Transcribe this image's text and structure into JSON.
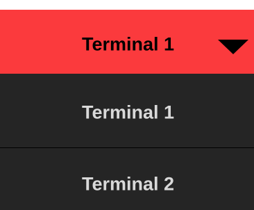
{
  "dropdown": {
    "selected_label": "Terminal 1",
    "caret_icon": "caret-down-icon",
    "options": [
      {
        "label": "Terminal 1"
      },
      {
        "label": "Terminal 2"
      }
    ]
  },
  "colors": {
    "toggle_background": "#fb3a3d",
    "menu_background": "#252525",
    "option_text": "#d9d9d9",
    "toggle_text": "#000000"
  }
}
